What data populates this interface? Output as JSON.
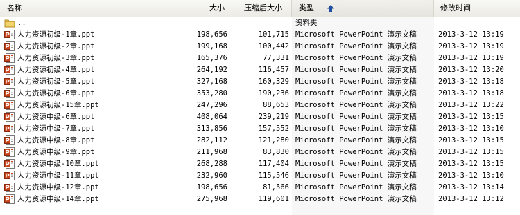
{
  "columns": {
    "name": "名称",
    "size": "大小",
    "compressed": "压缩后大小",
    "type": "类型",
    "modified": "修改时间"
  },
  "parent_row": {
    "name": "..",
    "type": "资料夹"
  },
  "files": [
    {
      "name": "人力资源初级-1章.ppt",
      "size": "198,656",
      "compressed": "101,715",
      "type": "Microsoft PowerPoint 演示文稿",
      "modified": "2013-3-12  13:19"
    },
    {
      "name": "人力资源初级-2章.ppt",
      "size": "199,168",
      "compressed": "100,442",
      "type": "Microsoft PowerPoint 演示文稿",
      "modified": "2013-3-12  13:19"
    },
    {
      "name": "人力资源初级-3章.ppt",
      "size": "165,376",
      "compressed": "77,331",
      "type": "Microsoft PowerPoint 演示文稿",
      "modified": "2013-3-12  13:19"
    },
    {
      "name": "人力资源初级-4章.ppt",
      "size": "264,192",
      "compressed": "116,457",
      "type": "Microsoft PowerPoint 演示文稿",
      "modified": "2013-3-12  13:20"
    },
    {
      "name": "人力资源初级-5章.ppt",
      "size": "327,168",
      "compressed": "160,329",
      "type": "Microsoft PowerPoint 演示文稿",
      "modified": "2013-3-12  13:18"
    },
    {
      "name": "人力资源初级-6章.ppt",
      "size": "353,280",
      "compressed": "190,236",
      "type": "Microsoft PowerPoint 演示文稿",
      "modified": "2013-3-12  13:18"
    },
    {
      "name": "人力资源初级-15章.ppt",
      "size": "247,296",
      "compressed": "88,653",
      "type": "Microsoft PowerPoint 演示文稿",
      "modified": "2013-3-12  13:22"
    },
    {
      "name": "人力资源中级-6章.ppt",
      "size": "408,064",
      "compressed": "239,219",
      "type": "Microsoft PowerPoint 演示文稿",
      "modified": "2013-3-12  13:15"
    },
    {
      "name": "人力资源中级-7章.ppt",
      "size": "313,856",
      "compressed": "157,552",
      "type": "Microsoft PowerPoint 演示文稿",
      "modified": "2013-3-12  13:10"
    },
    {
      "name": "人力资源中级-8章.ppt",
      "size": "282,112",
      "compressed": "121,280",
      "type": "Microsoft PowerPoint 演示文稿",
      "modified": "2013-3-12  13:15"
    },
    {
      "name": "人力资源中级-9章.ppt",
      "size": "211,968",
      "compressed": "83,830",
      "type": "Microsoft PowerPoint 演示文稿",
      "modified": "2013-3-12  13:15"
    },
    {
      "name": "人力资源中级-10章.ppt",
      "size": "268,288",
      "compressed": "117,404",
      "type": "Microsoft PowerPoint 演示文稿",
      "modified": "2013-3-12  13:15"
    },
    {
      "name": "人力资源中级-11章.ppt",
      "size": "232,960",
      "compressed": "115,546",
      "type": "Microsoft PowerPoint 演示文稿",
      "modified": "2013-3-12  13:10"
    },
    {
      "name": "人力资源中级-12章.ppt",
      "size": "198,656",
      "compressed": "81,566",
      "type": "Microsoft PowerPoint 演示文稿",
      "modified": "2013-3-12  13:14"
    },
    {
      "name": "人力资源中级-14章.ppt",
      "size": "275,968",
      "compressed": "119,601",
      "type": "Microsoft PowerPoint 演示文稿",
      "modified": "2013-3-12  13:12"
    }
  ],
  "icons": {
    "header_sort": "sort-ascending-icon",
    "parent": "folder-up-icon",
    "file": "powerpoint-file-icon"
  }
}
